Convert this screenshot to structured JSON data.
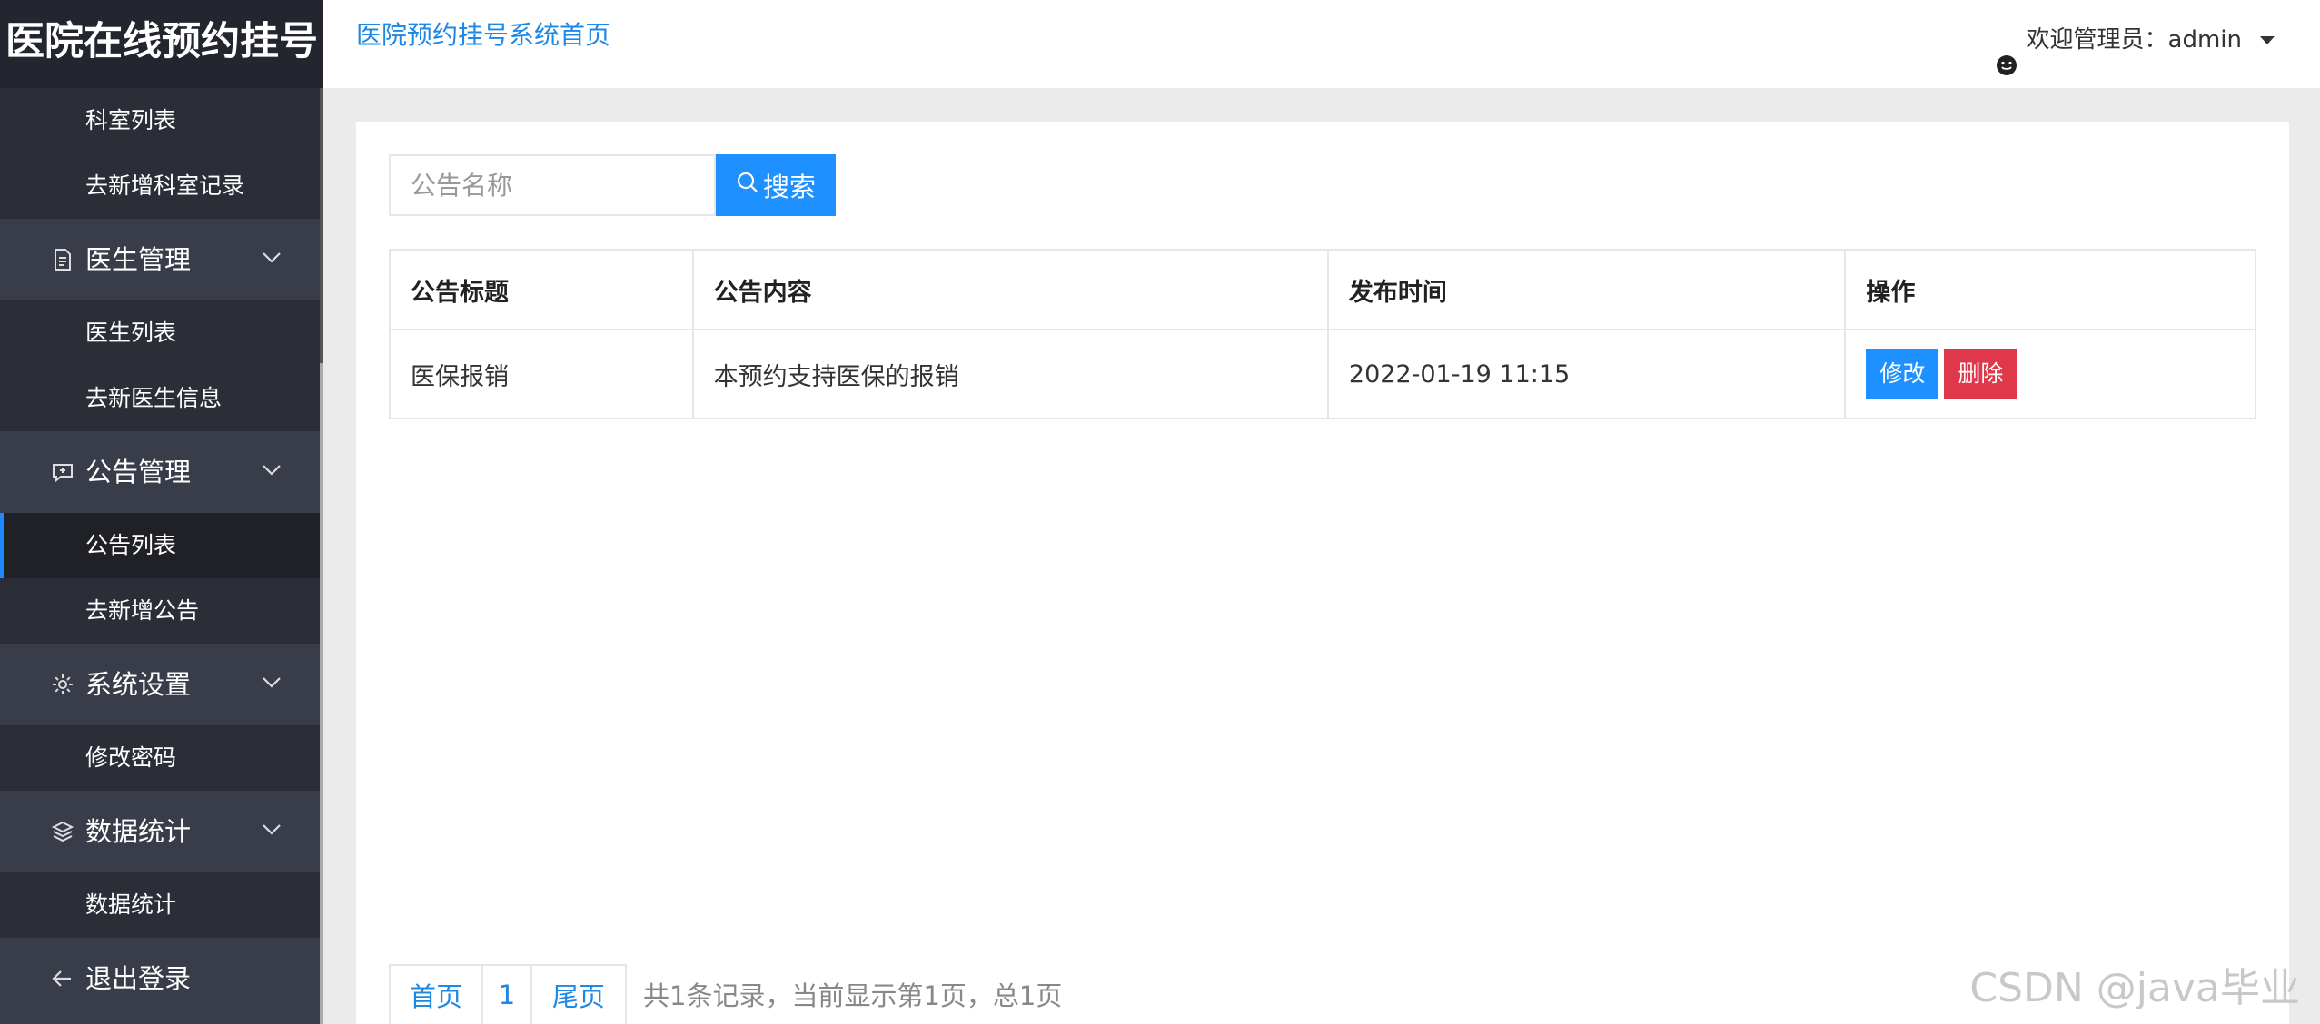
{
  "sidebar": {
    "logo": "医院在线预约挂号",
    "items": [
      {
        "type": "sub",
        "label": "科室列表"
      },
      {
        "type": "sub",
        "label": "去新增科室记录"
      },
      {
        "type": "group",
        "label": "医生管理",
        "icon": "document-icon"
      },
      {
        "type": "sub",
        "label": "医生列表"
      },
      {
        "type": "sub",
        "label": "去新医生信息"
      },
      {
        "type": "group",
        "label": "公告管理",
        "icon": "announcement-icon"
      },
      {
        "type": "sub",
        "label": "公告列表",
        "active": true
      },
      {
        "type": "sub",
        "label": "去新增公告"
      },
      {
        "type": "group",
        "label": "系统设置",
        "icon": "gear-icon"
      },
      {
        "type": "sub",
        "label": "修改密码"
      },
      {
        "type": "group",
        "label": "数据统计",
        "icon": "layers-icon"
      },
      {
        "type": "sub",
        "label": "数据统计"
      },
      {
        "type": "group",
        "label": "退出登录",
        "icon": "arrow-left-icon"
      }
    ]
  },
  "header": {
    "home_link": "医院预约挂号系统首页",
    "user_text": "欢迎管理员：admin"
  },
  "search": {
    "placeholder": "公告名称",
    "value": "",
    "button_label": "搜索"
  },
  "table": {
    "columns": [
      "公告标题",
      "公告内容",
      "发布时间",
      "操作"
    ],
    "rows": [
      {
        "title": "医保报销",
        "content": "本预约支持医保的报销",
        "time": "2022-01-19 11:15"
      }
    ],
    "edit_label": "修改",
    "delete_label": "删除"
  },
  "pagination": {
    "first": "首页",
    "current": "1",
    "last": "尾页",
    "info": "共1条记录，当前显示第1页，总1页"
  },
  "watermark": "CSDN @java毕业",
  "colors": {
    "accent": "#1e90ff",
    "danger": "#e0384b",
    "sidebar_bg": "#393d49",
    "sidebar_sub_bg": "#2b2e37"
  }
}
